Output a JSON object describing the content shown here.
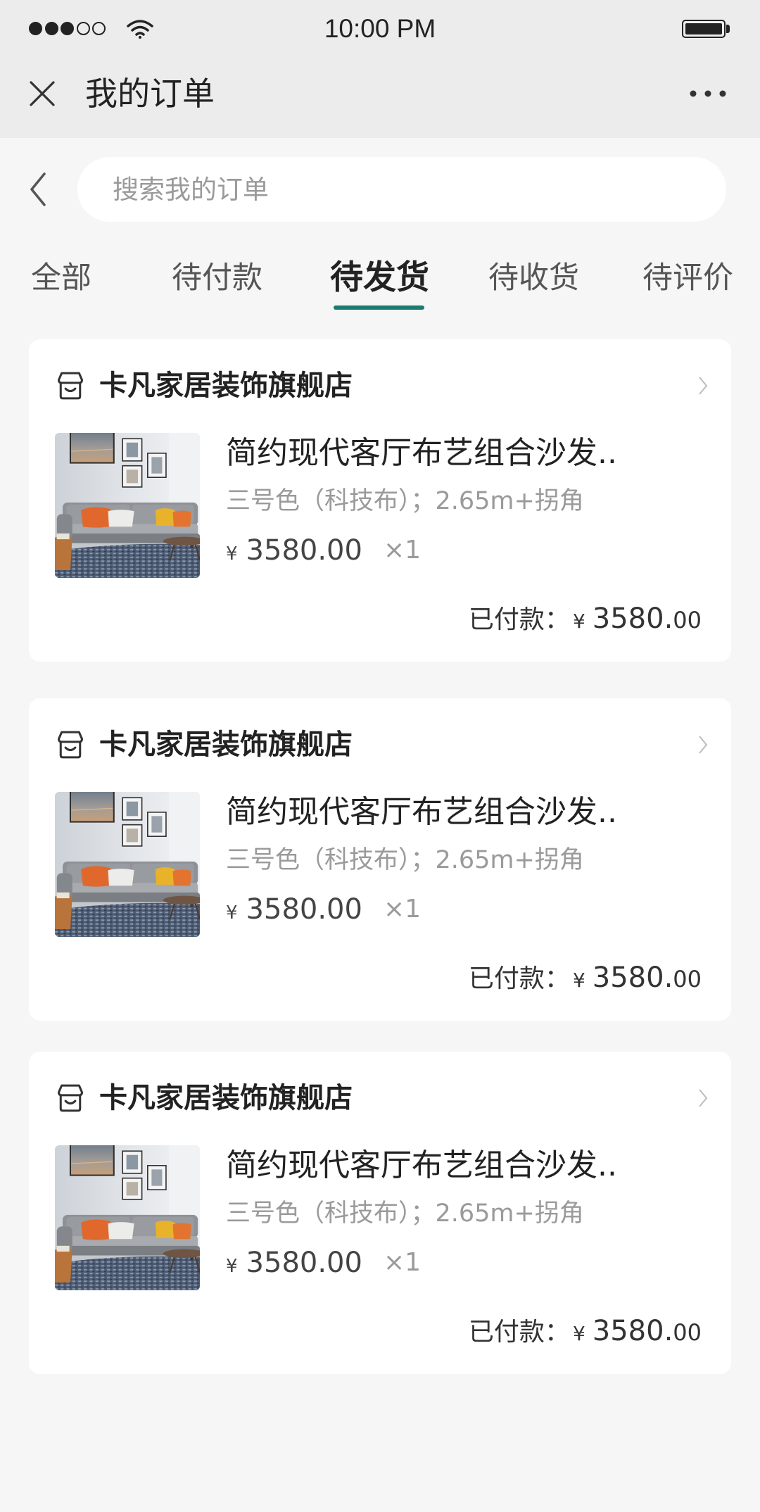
{
  "status_bar": {
    "time": "10:00 PM",
    "signal": {
      "strength": 3,
      "max": 5
    },
    "battery_level": 1.0
  },
  "nav": {
    "left_icon": "close-icon",
    "title": "我的订单",
    "right_icon": "more-icon"
  },
  "search": {
    "back_icon": "chevron-left-icon",
    "placeholder": "搜索我的订单",
    "value": ""
  },
  "tabs": {
    "items": [
      {
        "label": "全部"
      },
      {
        "label": "待付款"
      },
      {
        "label": "待发货"
      },
      {
        "label": "待收货"
      },
      {
        "label": "待评价"
      }
    ],
    "active_index": 2
  },
  "orders": [
    {
      "store_icon": "store-icon",
      "store_name": "卡凡家居装饰旗舰店",
      "chevron_icon": "chevron-right-icon",
      "product": {
        "title": "简约现代客厅布艺组合沙发..",
        "spec": "三号色（科技布）；2.65m+拐角",
        "currency": "¥",
        "price": "3580.00",
        "quantity": "×1"
      },
      "payment": {
        "label": "已付款：",
        "currency": "¥",
        "amount_integer": "3580.",
        "amount_decimal": "00"
      }
    },
    {
      "store_icon": "store-icon",
      "store_name": "卡凡家居装饰旗舰店",
      "chevron_icon": "chevron-right-icon",
      "product": {
        "title": "简约现代客厅布艺组合沙发..",
        "spec": "三号色（科技布）；2.65m+拐角",
        "currency": "¥",
        "price": "3580.00",
        "quantity": "×1"
      },
      "payment": {
        "label": "已付款：",
        "currency": "¥",
        "amount_integer": "3580.",
        "amount_decimal": "00"
      }
    },
    {
      "store_icon": "store-icon",
      "store_name": "卡凡家居装饰旗舰店",
      "chevron_icon": "chevron-right-icon",
      "product": {
        "title": "简约现代客厅布艺组合沙发..",
        "spec": "三号色（科技布）；2.65m+拐角",
        "currency": "¥",
        "price": "3580.00",
        "quantity": "×1"
      },
      "payment": {
        "label": "已付款：",
        "currency": "¥",
        "amount_integer": "3580.",
        "amount_decimal": "00"
      }
    }
  ],
  "colors": {
    "accent": "#1b7a71",
    "header_background": "#ececec",
    "page_background": "#f6f6f6",
    "card_background": "#ffffff",
    "primary_text": "#222222",
    "secondary_text": "#9a9a9a"
  }
}
